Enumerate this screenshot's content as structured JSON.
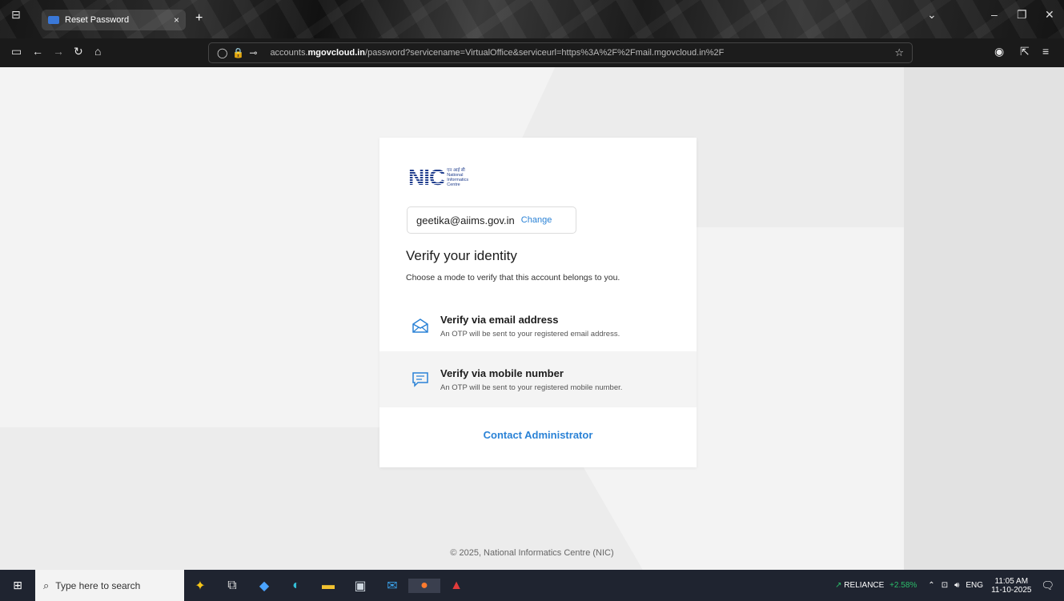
{
  "browser": {
    "tab_title": "Reset Password",
    "tab_close": "×",
    "new_tab": "+",
    "url_domain": "accounts.mgovcloud.in",
    "url_rest": "/password?servicename=VirtualOffice&serviceurl=https%3A%2F%2Fmail.mgovcloud.in%2F",
    "url_prefix": "accounts.",
    "url_host": "mgovcloud.in"
  },
  "card": {
    "logo_text": "NIC",
    "logo_sub": [
      "एन आई सी",
      "National",
      "Informatics",
      "Centre"
    ],
    "user_email": "geetika@aiims.gov.in",
    "change_label": "Change",
    "title": "Verify your identity",
    "subtitle": "Choose a mode to verify that this account belongs to you.",
    "options": [
      {
        "title": "Verify via email address",
        "desc": "An OTP will be sent to your registered email address.",
        "icon": "envelope-icon"
      },
      {
        "title": "Verify via mobile number",
        "desc": "An OTP will be sent to your registered mobile number.",
        "icon": "message-icon"
      }
    ],
    "contact_label": "Contact Administrator"
  },
  "footer": {
    "copyright": "© 2025, National Informatics Centre (NIC)"
  },
  "taskbar": {
    "search_placeholder": "Type here to search",
    "stock_name": "RELIANCE",
    "stock_change": "+2.58%",
    "lang": "ENG",
    "time": "11:05 AM",
    "date": "11-10-2025"
  },
  "colors": {
    "accent": "#2a82d6",
    "logo_blue": "#1e3c8c",
    "stock_green": "#2bbd6a"
  }
}
